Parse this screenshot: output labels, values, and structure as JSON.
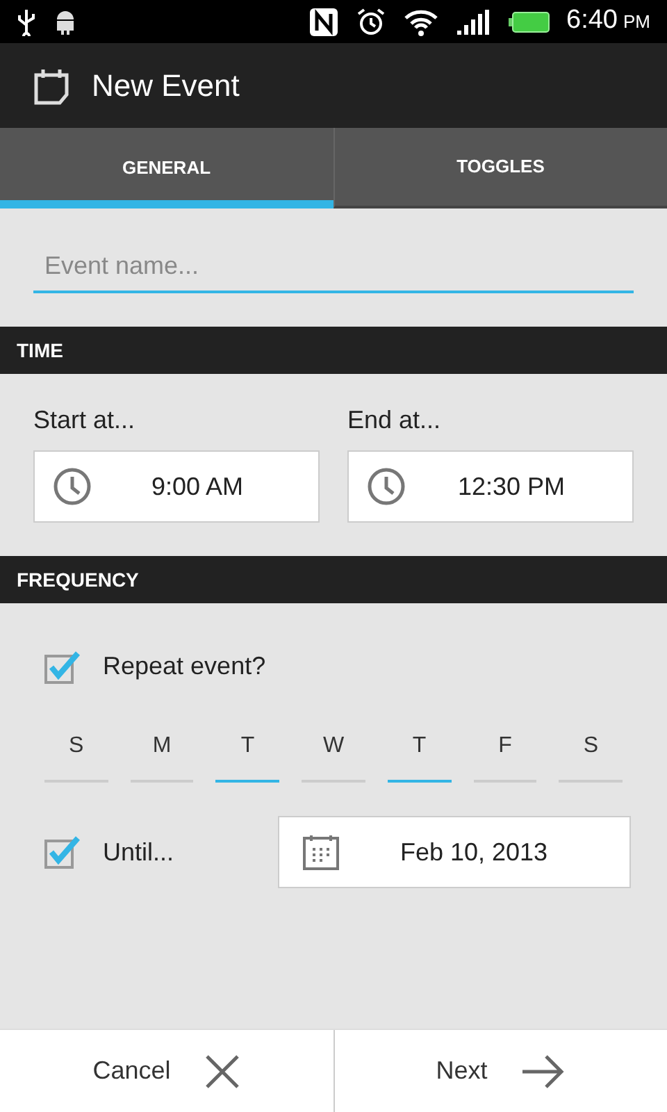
{
  "status_bar": {
    "time": "6:40",
    "meridiem": "PM"
  },
  "action_bar": {
    "title": "New Event"
  },
  "tabs": [
    {
      "label": "GENERAL",
      "selected": true
    },
    {
      "label": "TOGGLES",
      "selected": false
    }
  ],
  "event_name": {
    "placeholder": "Event name..."
  },
  "time_section": {
    "header": "TIME",
    "start": {
      "label": "Start at...",
      "value": "9:00 AM"
    },
    "end": {
      "label": "End at...",
      "value": "12:30 PM"
    }
  },
  "frequency_section": {
    "header": "FREQUENCY",
    "repeat": {
      "label": "Repeat event?",
      "checked": true
    },
    "days": [
      {
        "label": "S",
        "selected": false
      },
      {
        "label": "M",
        "selected": false
      },
      {
        "label": "T",
        "selected": true
      },
      {
        "label": "W",
        "selected": false
      },
      {
        "label": "T",
        "selected": true
      },
      {
        "label": "F",
        "selected": false
      },
      {
        "label": "S",
        "selected": false
      }
    ],
    "until": {
      "label": "Until...",
      "checked": true,
      "date": "Feb 10, 2013"
    }
  },
  "buttons": [
    {
      "label": "Cancel",
      "kind": "cancel"
    },
    {
      "label": "Next",
      "kind": "next"
    }
  ]
}
